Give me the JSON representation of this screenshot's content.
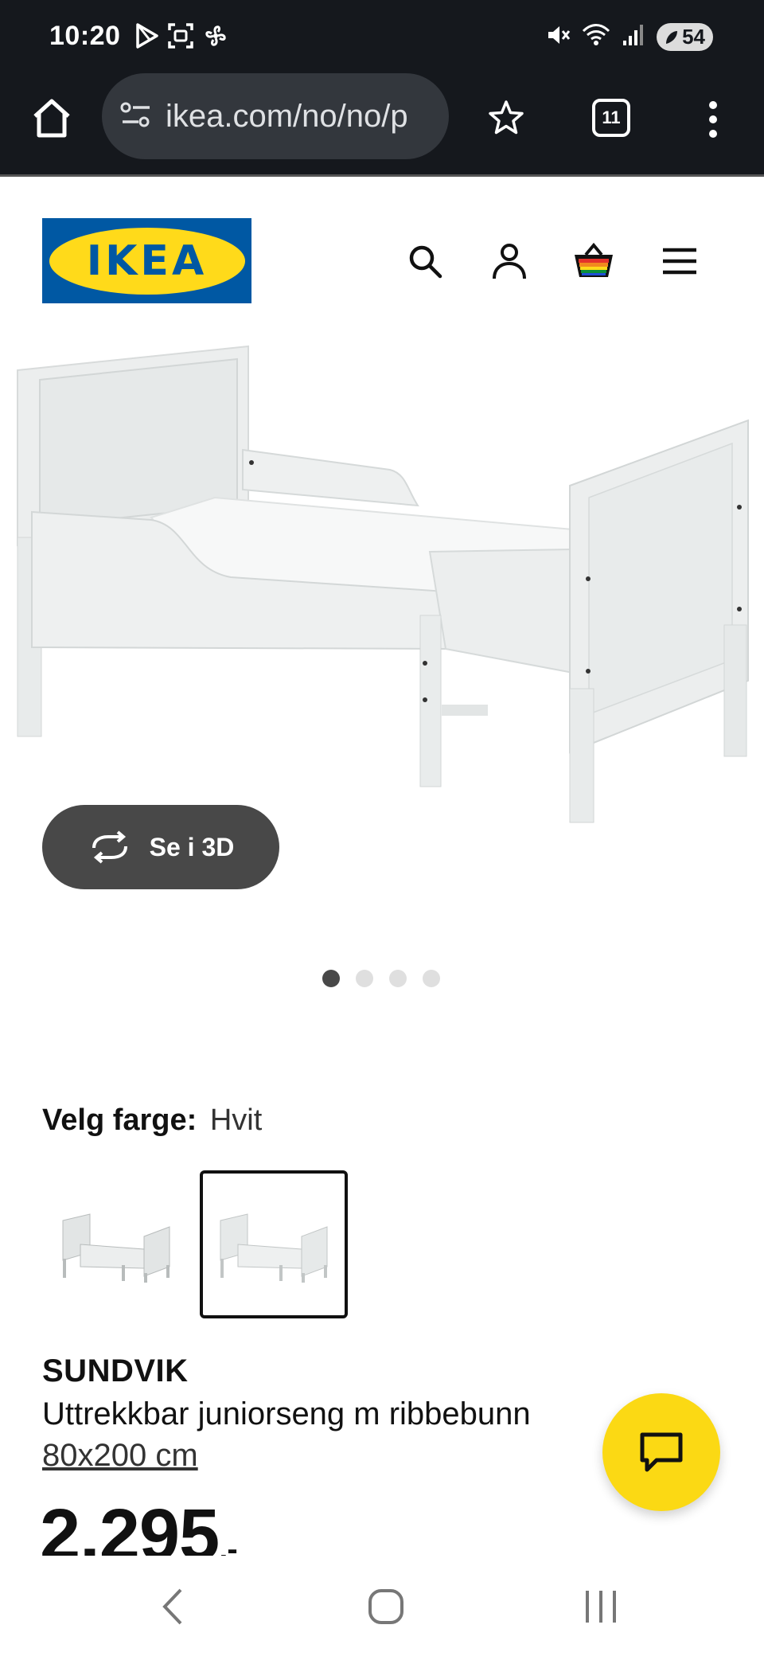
{
  "status_bar": {
    "time": "10:20",
    "battery": "54",
    "left_icons": [
      "play-store-icon",
      "screenshot-icon",
      "pinwheel-icon"
    ],
    "right_icons": [
      "mute-icon",
      "wifi-icon",
      "signal-icon",
      "battery-icon"
    ]
  },
  "browser": {
    "url": "ikea.com/no/no/p",
    "tab_count": "11"
  },
  "header": {
    "logo_text": "IKEA",
    "icons": [
      "search-icon",
      "account-icon",
      "cart-icon",
      "hamburger-menu-icon"
    ]
  },
  "gallery": {
    "view_3d_label": "Se i 3D",
    "dot_count": 4,
    "active_dot": 0
  },
  "color": {
    "label": "Velg farge:",
    "value": "Hvit",
    "selected_swatch": 1
  },
  "product": {
    "name": "SUNDVIK",
    "description": "Uttrekkbar juniorseng m ribbebunn",
    "size": "80x200 cm",
    "price": "2.295",
    "price_suffix": ",-"
  },
  "colors": {
    "ikea_blue": "#0058a3",
    "ikea_yellow": "#ffda1a",
    "chat_yellow": "#fbd914",
    "chrome_dark": "#15181d",
    "button_dark": "#484848"
  }
}
